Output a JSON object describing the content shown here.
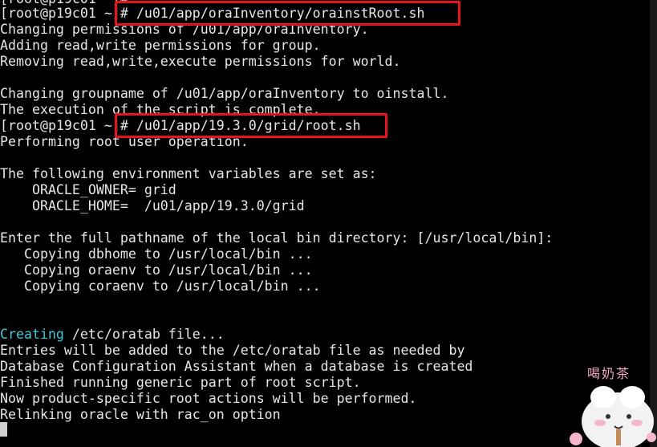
{
  "terminal": {
    "lines": [
      "[root@p19c01 ~]#",
      "[root@p19c01 ~]# /u01/app/oraInventory/orainstRoot.sh",
      "Changing permissions of /u01/app/oraInventory.",
      "Adding read,write permissions for group.",
      "Removing read,write,execute permissions for world.",
      "",
      "Changing groupname of /u01/app/oraInventory to oinstall.",
      "The execution of the script is complete.",
      "[root@p19c01 ~]# /u01/app/19.3.0/grid/root.sh",
      "Performing root user operation.",
      "",
      "The following environment variables are set as:",
      "    ORACLE_OWNER= grid",
      "    ORACLE_HOME=  /u01/app/19.3.0/grid",
      "",
      "Enter the full pathname of the local bin directory: [/usr/local/bin]:",
      "   Copying dbhome to /usr/local/bin ...",
      "   Copying oraenv to /usr/local/bin ...",
      "   Copying coraenv to /usr/local/bin ...",
      "",
      "",
      "Creating",
      "Entries will be added to the /etc/oratab file as needed by",
      "Database Configuration Assistant when a database is created",
      "Finished running generic part of root script.",
      "Now product-specific root actions will be performed.",
      "Relinking oracle with rac_on option"
    ],
    "creating_rest": " /etc/oratab file...",
    "sticker_text": "喝奶茶",
    "colors": {
      "background": "#000000",
      "foreground": "#e6e6e6",
      "highlight_box": "#e8141c",
      "keyword_cyan": "#3fc7d8"
    }
  }
}
